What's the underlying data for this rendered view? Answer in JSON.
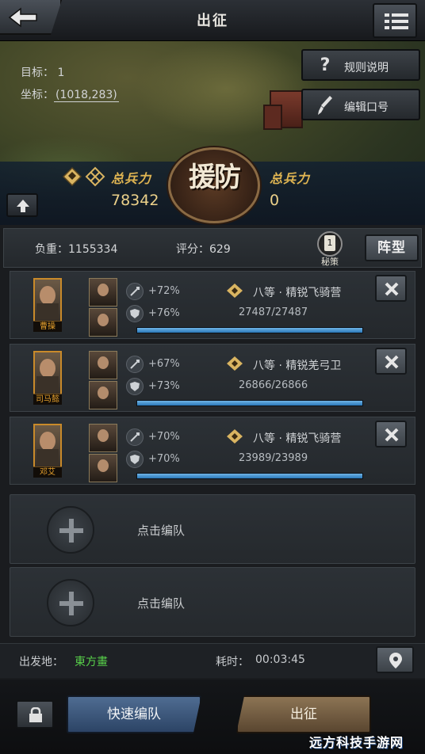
{
  "header": {
    "title": "出征"
  },
  "target": {
    "label": "目标：",
    "value": "1",
    "coord_label": "坐标：",
    "coord_value": "(1018,283)"
  },
  "side_menu": [
    {
      "label": "规则说明",
      "icon": "question-icon"
    },
    {
      "label": "编辑口号",
      "icon": "brush-icon"
    }
  ],
  "troops": {
    "left_label": "总兵力",
    "left_value": "78342",
    "right_label": "总兵力",
    "right_value": "0",
    "emblem": "援防"
  },
  "stats": {
    "load_label": "负重：",
    "load_value": "1155334",
    "score_label": "评分：",
    "score_value": "629",
    "secret_badge": "1",
    "secret_label": "秘策",
    "formation_label": "阵型"
  },
  "squads": [
    {
      "hero": "曹操",
      "attack": "+72%",
      "defense": "+76%",
      "unit": "八等 · 精锐飞骑营",
      "count": "27487/27487",
      "fill": 1.0
    },
    {
      "hero": "司马懿",
      "attack": "+67%",
      "defense": "+73%",
      "unit": "八等 · 精锐羌弓卫",
      "count": "26866/26866",
      "fill": 1.0
    },
    {
      "hero": "邓艾",
      "attack": "+70%",
      "defense": "+70%",
      "unit": "八等 · 精锐飞骑营",
      "count": "23989/23989",
      "fill": 1.0
    }
  ],
  "empty_slots": [
    {
      "label": "点击编队"
    },
    {
      "label": "点击编队"
    }
  ],
  "depart": {
    "label": "出发地：",
    "value": "東方畫",
    "time_label": "耗时：",
    "time_value": "00:03:45",
    "value_color": "#58d14a"
  },
  "actions": {
    "quick_label": "快速编队",
    "march_label": "出征"
  },
  "watermark": "远方科技手游网"
}
